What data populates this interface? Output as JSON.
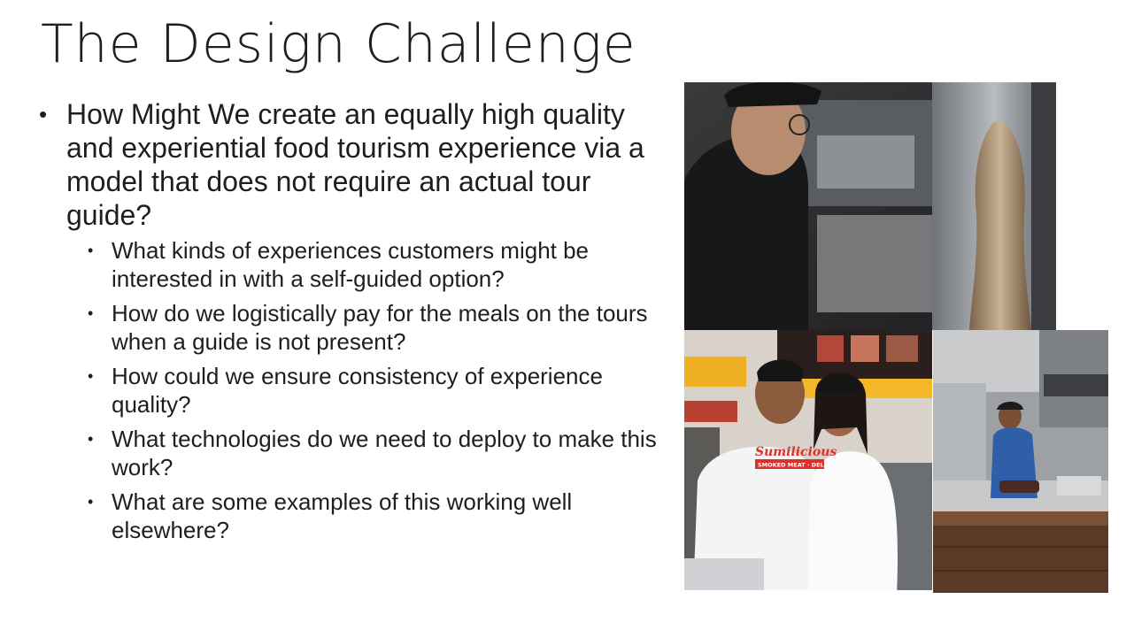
{
  "slide": {
    "title": "The Design Challenge",
    "main_point": "How Might We create an equally high quality and experiential food tourism experience via a model that does not require an actual tour guide?",
    "sub_points": [
      "What kinds of experiences customers might be interested in with a self-guided option?",
      "How do we logistically pay for the meals on the tours when a guide is not present?",
      "How could we ensure consistency of experience quality?",
      "What technologies do we need to deploy to make this work?",
      "What are some examples of this working well elsewhere?"
    ]
  },
  "photos": {
    "couple": {
      "shirt_logo": "Sumilicious",
      "shirt_tagline": "SMOKED MEAT · DELI"
    }
  }
}
